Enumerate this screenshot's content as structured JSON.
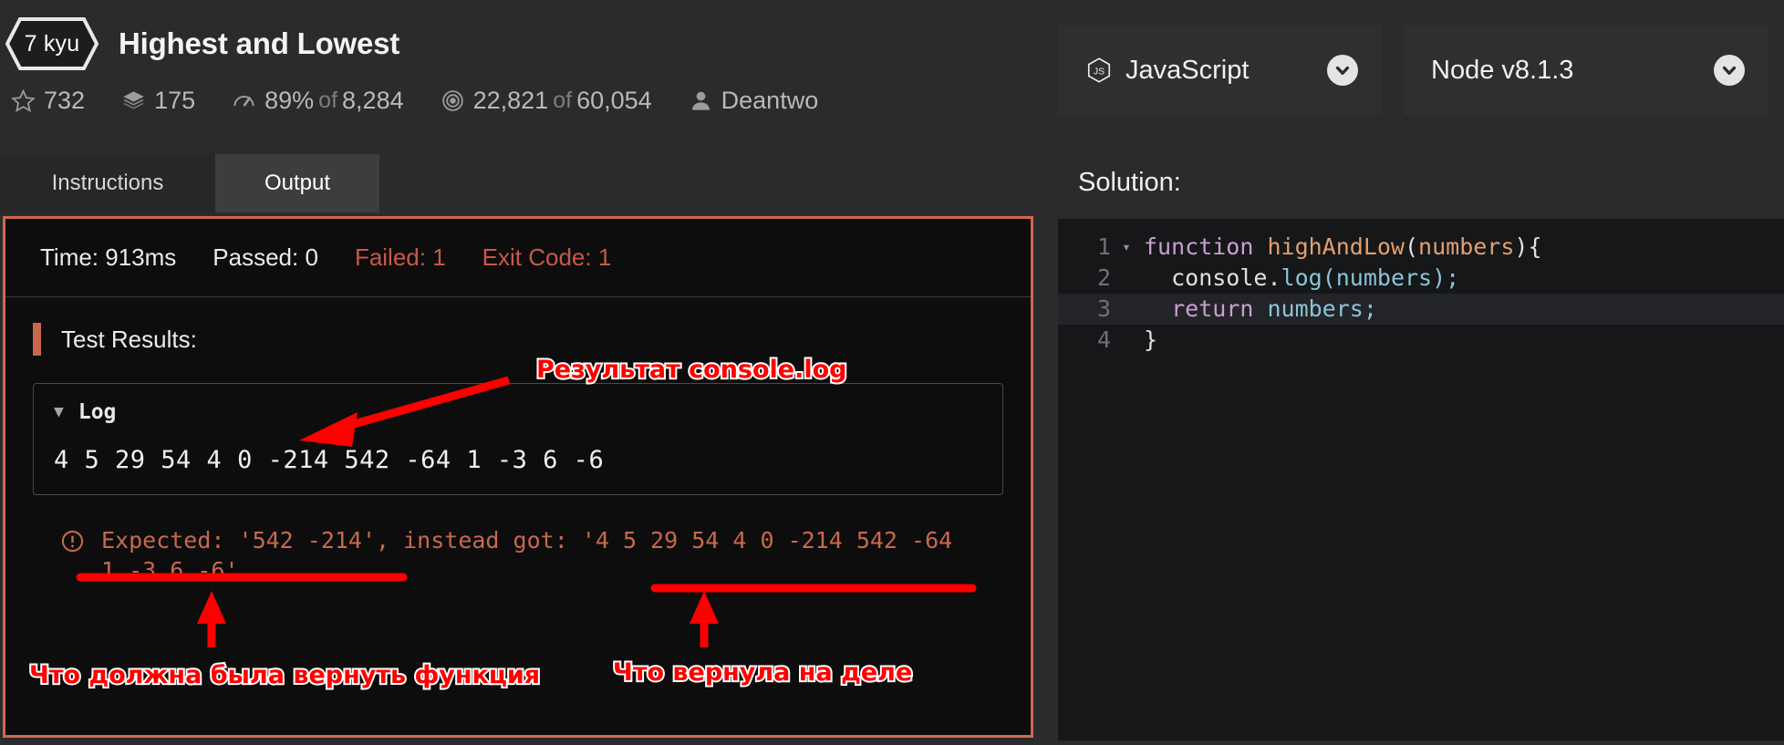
{
  "kata": {
    "rank": "7 kyu",
    "title": "Highest and Lowest",
    "stats": {
      "stars_icon": "star-icon",
      "stars": "732",
      "layers_icon": "layers-icon",
      "layers": "175",
      "satisfaction_icon": "gauge-icon",
      "satisfaction_pct": "89%",
      "satisfaction_of": "of",
      "satisfaction_total": "8,284",
      "completions_icon": "target-icon",
      "completions": "22,821",
      "completions_of": "of",
      "completions_total": "60,054",
      "author_icon": "user-icon",
      "author": "Deantwo"
    }
  },
  "tabs": [
    {
      "label": "Instructions",
      "active": false
    },
    {
      "label": "Output",
      "active": true
    }
  ],
  "output": {
    "summary": {
      "time_label": "Time:",
      "time_value": "913ms",
      "passed_label": "Passed:",
      "passed_value": "0",
      "failed_label": "Failed:",
      "failed_value": "1",
      "exit_label": "Exit Code:",
      "exit_value": "1",
      "time": "Time: 913ms",
      "passed": "Passed: 0",
      "failed": "Failed: 1",
      "exit_code": "Exit Code: 1"
    },
    "test_results_label": "Test Results:",
    "log": {
      "caret": "▼",
      "title": "Log",
      "line": "4 5 29 54 4 0 -214 542 -64 1 -3 6 -6"
    },
    "error": {
      "icon": "exclamation-circle-icon",
      "text": "Expected: '542 -214', instead got: '4 5 29 54 4 0 -214 542 -64 1 -3 6 -6'"
    }
  },
  "editor": {
    "language": "JavaScript",
    "language_icon": "js-icon",
    "runtime": "Node v8.1.3",
    "dropdown_icon": "chevron-down-icon",
    "solution_label": "Solution:",
    "code_lines": [
      {
        "number": "1",
        "fold": "▾",
        "active": false,
        "tokens": [
          {
            "t": "function ",
            "c": "tok-kw"
          },
          {
            "t": "highAndLow",
            "c": "tok-fn"
          },
          {
            "t": "(",
            "c": "tok-pl"
          },
          {
            "t": "numbers",
            "c": "tok-fn"
          },
          {
            "t": "){",
            "c": "tok-pl"
          }
        ]
      },
      {
        "number": "2",
        "fold": "",
        "active": false,
        "tokens": [
          {
            "t": "  console",
            "c": "tok-pl"
          },
          {
            "t": ".",
            "c": "tok-pl"
          },
          {
            "t": "log",
            "c": "tok-var"
          },
          {
            "t": "(",
            "c": "tok-var"
          },
          {
            "t": "numbers",
            "c": "tok-var"
          },
          {
            "t": ");",
            "c": "tok-var"
          }
        ]
      },
      {
        "number": "3",
        "fold": "",
        "active": true,
        "tokens": [
          {
            "t": "  ",
            "c": "tok-pl"
          },
          {
            "t": "return ",
            "c": "tok-kw"
          },
          {
            "t": "numbers",
            "c": "tok-var"
          },
          {
            "t": ";",
            "c": "tok-var"
          }
        ]
      },
      {
        "number": "4",
        "fold": "",
        "active": false,
        "tokens": [
          {
            "t": "}",
            "c": "tok-pl"
          }
        ]
      }
    ]
  },
  "annotations": {
    "console_log": "Результат console.log",
    "should_return": "Что должна была вернуть функция",
    "actual_return": "Что вернула на деле"
  },
  "colors": {
    "accent_red": "#c8684f",
    "annotation_red": "#ff0000",
    "panel_bg": "#2b2b2e",
    "output_bg": "#0d0d0d",
    "code_bg": "#161719"
  }
}
